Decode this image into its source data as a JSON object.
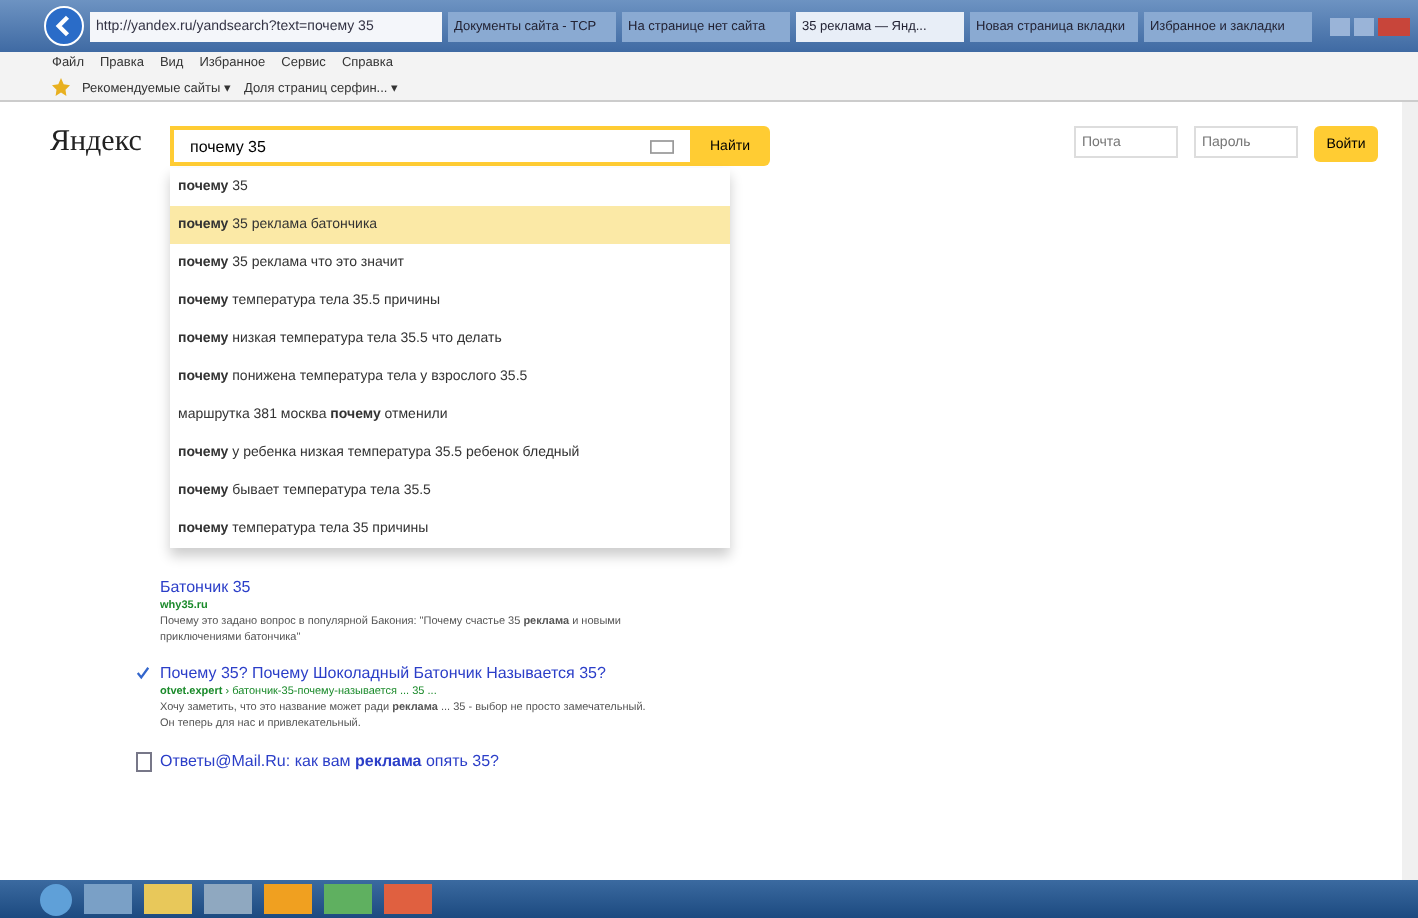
{
  "browser": {
    "address": "http://yandex.ru/yandsearch?text=почему 35",
    "tabs": [
      {
        "title": "Документы сайта - ТСР",
        "selected": false
      },
      {
        "title": "На странице нет сайта",
        "selected": false
      },
      {
        "title": "35 реклама — Янд...",
        "selected": true
      },
      {
        "title": "Новая страница вкладки",
        "selected": false
      },
      {
        "title": "Избранное и закладки",
        "selected": false
      }
    ],
    "menu": [
      "Файл",
      "Правка",
      "Вид",
      "Избранное",
      "Сервис",
      "Справка"
    ],
    "favorites": [
      "Рекомендуемые сайты ▾",
      "Доля страниц серфин... ▾"
    ]
  },
  "yandex": {
    "logo": "Яндекс",
    "query": "почему 35",
    "search_button": "Найти",
    "login_placeholder": "Почта",
    "password_placeholder": "Пароль",
    "login_button": "Войти"
  },
  "suggestions": [
    {
      "text": "**почему** 35",
      "selected": false
    },
    {
      "text": "**почему** 35 реклама батончика",
      "selected": true
    },
    {
      "text": "**почему** 35 реклама что это значит",
      "selected": false
    },
    {
      "text": "**почему** температура тела 35.5 причины",
      "selected": false
    },
    {
      "text": "**почему** низкая температура тела 35.5 что делать",
      "selected": false
    },
    {
      "text": "**почему** понижена температура тела у взрослого 35.5",
      "selected": false
    },
    {
      "text": "маршрутка 381 москва **почему** отменили",
      "selected": false
    },
    {
      "text": "**почему** у ребенка низкая температура 35.5 ребенок бледный",
      "selected": false
    },
    {
      "text": "**почему** бывает температура тела 35.5",
      "selected": false
    },
    {
      "text": "**почему** температура тела 35 причины",
      "selected": false
    }
  ],
  "results": [
    {
      "title": "Батончик 35",
      "url": "why35.ru",
      "snippet": "Почему это задано вопрос в популярной Бакония: \"Почему счастье 35 **реклама** и новыми приключениями батончика\"",
      "checked": false
    },
    {
      "title": "Почему 35? Почему Шоколадный Батончик Называется 35?",
      "url": "otvet.expert",
      "url_extra": " › батончик-35-почему-называется ... 35 ...",
      "snippet": "Хочу заметить, что это название может ради **реклама** ... 35 - выбор не просто замечательный. Он теперь для нас и привлекательный.",
      "checked": true
    }
  ],
  "answer": {
    "title": "Ответы@Mail.Ru: как вам **реклама** опять 35?"
  }
}
